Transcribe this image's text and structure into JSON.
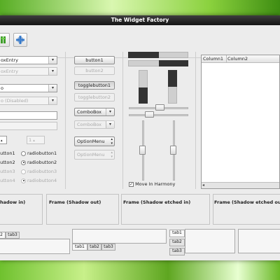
{
  "window": {
    "title": "The Widget Factory"
  },
  "toolbar": {
    "icons": [
      "green-tool-icon",
      "add-icon"
    ]
  },
  "left": {
    "combo_entry": "oxEntry",
    "combo_entry_disabled": "oxEntry",
    "combo_box": "o",
    "combo_box_disabled": "o (Disabled)",
    "entry_value": "",
    "entry_disabled_value": "",
    "spin_value": "",
    "spin_disabled_value": "1",
    "radios_left": [
      {
        "label": "button1",
        "checked": false,
        "disabled": false
      },
      {
        "label": "button2",
        "checked": false,
        "disabled": false
      },
      {
        "label": "button3",
        "checked": false,
        "disabled": true
      },
      {
        "label": "button4",
        "checked": false,
        "disabled": true
      }
    ],
    "radios_right": [
      {
        "label": "radiobutton1",
        "checked": false,
        "disabled": false
      },
      {
        "label": "radiobutton2",
        "checked": true,
        "disabled": false
      },
      {
        "label": "radiobutton3",
        "checked": false,
        "disabled": true
      },
      {
        "label": "radiobutton4",
        "checked": true,
        "disabled": true
      }
    ]
  },
  "buttons": {
    "button1": "button1",
    "button2": "button2",
    "toggle1": "togglebutton1",
    "toggle2": "togglebutton2",
    "combo": "ComboBox",
    "combo_disabled": "ComboBox",
    "option": "OptionMenu",
    "option_disabled": "OptionMenu"
  },
  "harmony": {
    "label": "Move In Harmony",
    "checked": true
  },
  "tree": {
    "columns": [
      "Column1",
      "Column2"
    ]
  },
  "frames": {
    "shadow_in": "hadow in)",
    "shadow_out": "Frame (Shadow out)",
    "etched_in": "Frame (Shadow etched in)",
    "etched_out": "Frame (Shadow etched ou"
  },
  "tabs": {
    "set1": [
      "2",
      "tab3"
    ],
    "set2": [
      "tab1",
      "tab2",
      "tab3"
    ],
    "set3": [
      "tab1",
      "tab2",
      "tab3"
    ]
  }
}
